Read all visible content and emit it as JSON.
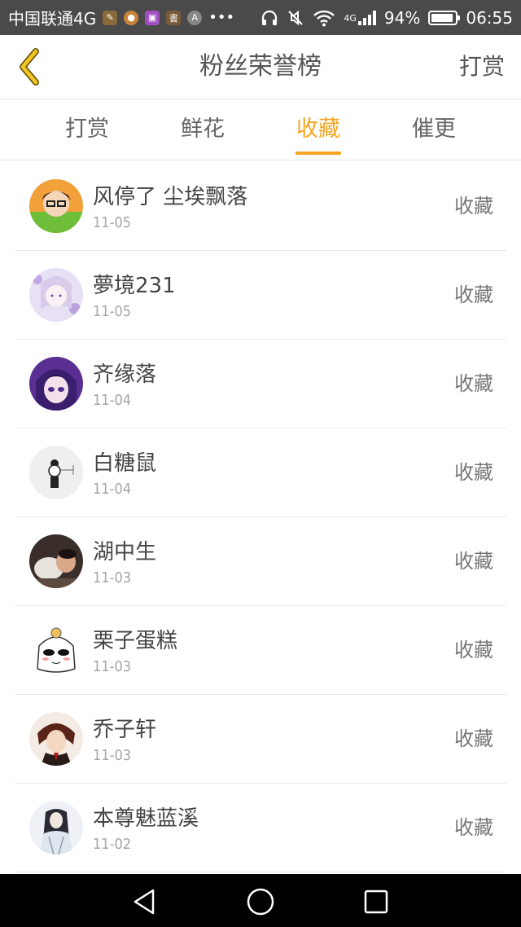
{
  "status_bar": {
    "carrier": "中国联通4G",
    "network": "4G",
    "battery_percent": "94%",
    "battery_level": 0.94,
    "time": "06:55"
  },
  "header": {
    "back_icon": "chevron-left-icon",
    "title": "粉丝荣誉榜",
    "right_action": "打赏"
  },
  "tabs": [
    {
      "label": "打赏",
      "active": false
    },
    {
      "label": "鲜花",
      "active": false
    },
    {
      "label": "收藏",
      "active": true
    },
    {
      "label": "催更",
      "active": false
    }
  ],
  "fans": [
    {
      "name": "风停了 尘埃飘落",
      "date": "11-05",
      "action": "收藏"
    },
    {
      "name": "夢境231",
      "date": "11-05",
      "action": "收藏"
    },
    {
      "name": "齐缘落",
      "date": "11-04",
      "action": "收藏"
    },
    {
      "name": "白糖鼠",
      "date": "11-04",
      "action": "收藏"
    },
    {
      "name": "湖中生",
      "date": "11-03",
      "action": "收藏"
    },
    {
      "name": "栗子蛋糕",
      "date": "11-03",
      "action": "收藏"
    },
    {
      "name": "乔子轩",
      "date": "11-03",
      "action": "收藏"
    },
    {
      "name": "本尊魅蓝溪",
      "date": "11-02",
      "action": "收藏"
    }
  ],
  "colors": {
    "accent": "#f5a623",
    "status_bar": "#4a4a4a",
    "nav_bar": "#000000"
  }
}
